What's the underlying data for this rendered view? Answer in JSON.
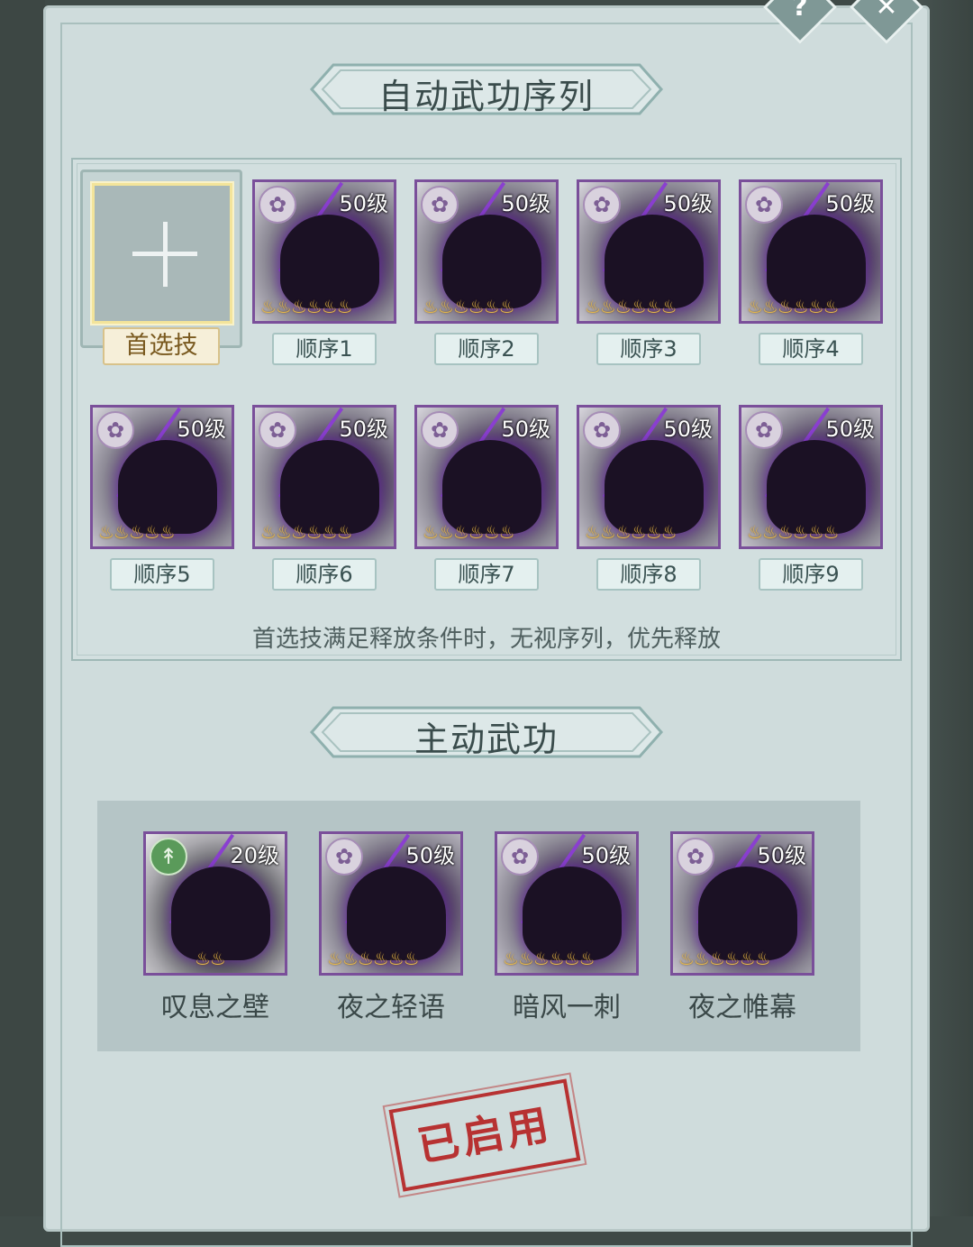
{
  "header": {
    "help_icon": "question-icon",
    "close_icon": "close-icon",
    "help_glyph": "?",
    "close_glyph": "✕"
  },
  "sequence": {
    "title": "自动武功序列",
    "first": {
      "label": "首选技",
      "icon": "plus-icon"
    },
    "slots": [
      {
        "label": "顺序1",
        "level": "50级",
        "stars": 6
      },
      {
        "label": "顺序2",
        "level": "50级",
        "stars": 6
      },
      {
        "label": "顺序3",
        "level": "50级",
        "stars": 6
      },
      {
        "label": "顺序4",
        "level": "50级",
        "stars": 6
      },
      {
        "label": "顺序5",
        "level": "50级",
        "stars": 5
      },
      {
        "label": "顺序6",
        "level": "50级",
        "stars": 6
      },
      {
        "label": "顺序7",
        "level": "50级",
        "stars": 6
      },
      {
        "label": "顺序8",
        "level": "50级",
        "stars": 6
      },
      {
        "label": "顺序9",
        "level": "50级",
        "stars": 6
      }
    ],
    "hint": "首选技满足释放条件时，无视序列，优先释放"
  },
  "active": {
    "title": "主动武功",
    "skills": [
      {
        "name": "叹息之壁",
        "level": "20级",
        "stars": 2,
        "emblem": "green"
      },
      {
        "name": "夜之轻语",
        "level": "50级",
        "stars": 6,
        "emblem": "purple"
      },
      {
        "name": "暗风一刺",
        "level": "50级",
        "stars": 6,
        "emblem": "purple"
      },
      {
        "name": "夜之帷幕",
        "level": "50级",
        "stars": 6,
        "emblem": "purple"
      }
    ]
  },
  "status": {
    "stamp": "已启用"
  },
  "colors": {
    "panel": "#cfdcdc",
    "rare_border": "#7a4f9a",
    "star": "#e6b84a",
    "stamp": "#b73232",
    "first_border": "#f3e49a"
  }
}
